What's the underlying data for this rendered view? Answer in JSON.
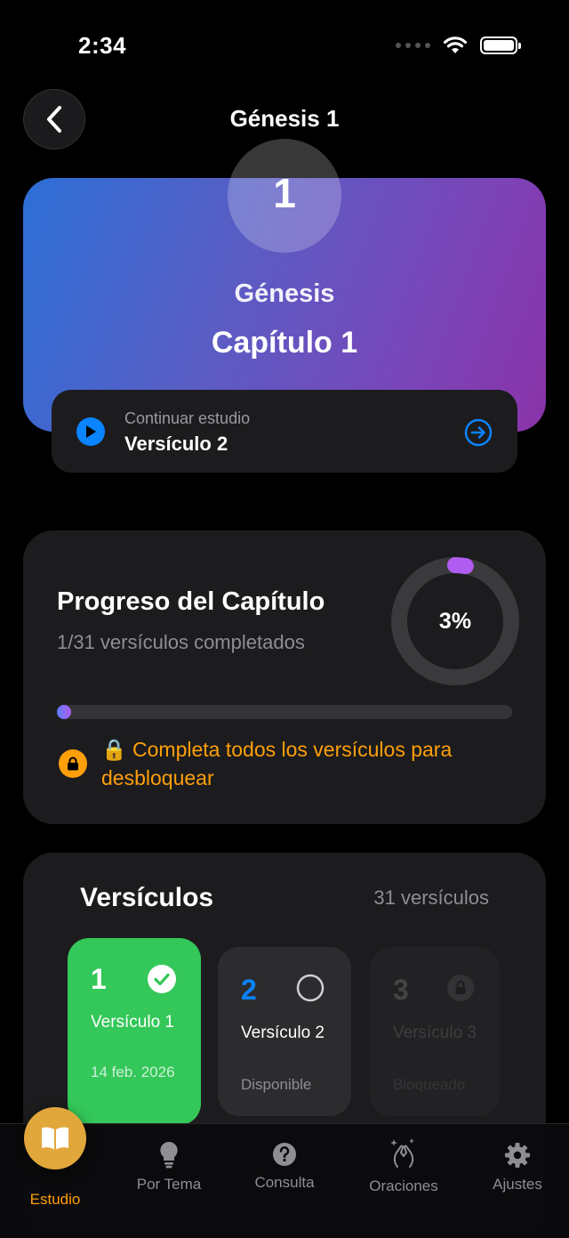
{
  "status_bar": {
    "time": "2:34"
  },
  "nav": {
    "title": "Génesis 1"
  },
  "hero": {
    "number": "1",
    "book": "Génesis",
    "chapter": "Capítulo 1"
  },
  "continue": {
    "label": "Continuar estudio",
    "value": "Versículo 2"
  },
  "progress": {
    "title": "Progreso del Capítulo",
    "subtitle": "1/31 versículos completados",
    "percent_label": "3%",
    "fraction": 0.03,
    "lock_message": "🔒 Completa todos los versículos para desbloquear"
  },
  "verses": {
    "title": "Versículos",
    "count": "31 versículos",
    "items": [
      {
        "number": "1",
        "label": "Versículo 1",
        "sub": "14 feb. 2026",
        "state": "completed"
      },
      {
        "number": "2",
        "label": "Versículo 2",
        "sub": "Disponible",
        "state": "available"
      },
      {
        "number": "3",
        "label": "Versículo 3",
        "sub": "Bloqueado",
        "state": "locked"
      }
    ]
  },
  "tabs": [
    {
      "label": "Estudio",
      "icon": "book-icon",
      "active": true
    },
    {
      "label": "Por Tema",
      "icon": "lightbulb-icon"
    },
    {
      "label": "Consulta",
      "icon": "question-icon"
    },
    {
      "label": "Oraciones",
      "icon": "praying-hands-icon"
    },
    {
      "label": "Ajustes",
      "icon": "gear-icon"
    }
  ],
  "colors": {
    "accent_blue": "#0a84ff",
    "success_green": "#34c759",
    "warning_orange": "#ff9f0a",
    "active_tab": "#e2a73b",
    "progress_purple": "#b05cf0"
  }
}
